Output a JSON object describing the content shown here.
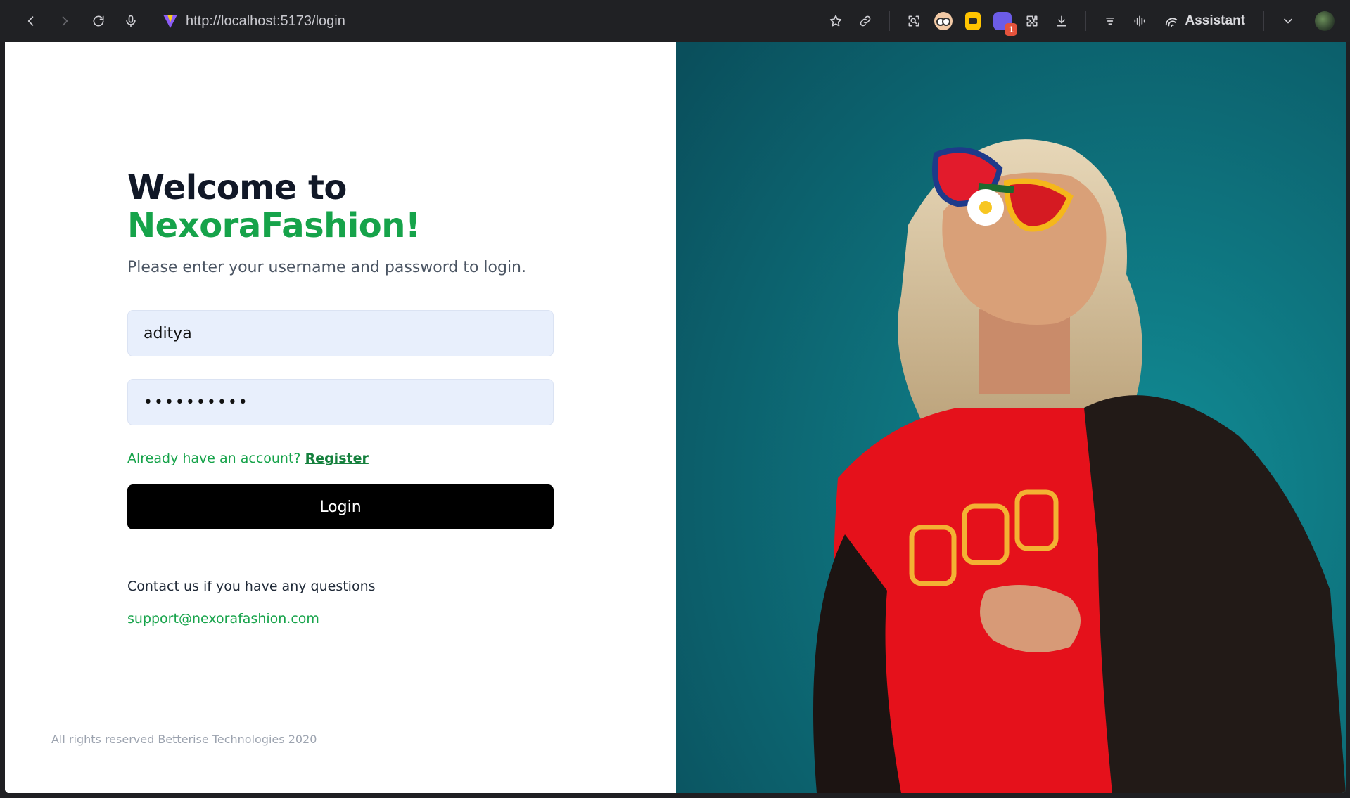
{
  "browser": {
    "url": "http://localhost:5173/login",
    "assistant_label": "Assistant",
    "extension_badge": "1"
  },
  "login": {
    "title_line1": "Welcome to",
    "title_brand": "NexoraFashion!",
    "subtitle": "Please enter your username and password to login.",
    "username_value": "aditya",
    "password_value": "••••••••••",
    "register_prompt": "Already have an account?",
    "register_link": "Register",
    "login_button": "Login",
    "contact_text": "Contact us if you have any questions",
    "contact_email": "support@nexorafashion.com",
    "footer": "All rights reserved Betterise Technologies 2020"
  },
  "colors": {
    "brand_green": "#16a34a",
    "input_bg": "#e8effc",
    "button_bg": "#000000",
    "hero_bg": "#0c7581"
  }
}
